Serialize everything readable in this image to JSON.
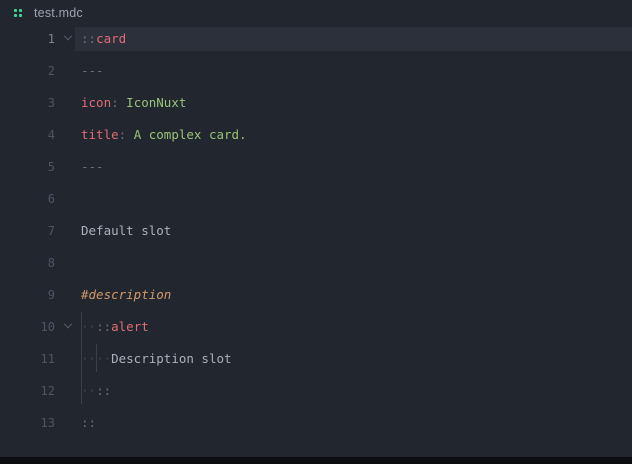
{
  "colors": {
    "background": "#22262e",
    "active_line": "#2b303b",
    "tab_text": "#9ca3b0",
    "icon_green": "#3fd68f",
    "line_number": "#4d5566",
    "line_number_active": "#7e8695",
    "punctuation": "#66707f",
    "tag": "#e06c75",
    "key": "#e06c75",
    "string": "#98c379",
    "text": "#a9b1be",
    "slot": "#d19a66",
    "whitespace": "#404654",
    "indent_guide": "#3a404c",
    "chevron": "#5a6272",
    "bottom_bar": "#0b0d11"
  },
  "tab": {
    "filename": "test.mdc",
    "icon": "mdc-four-dots-icon"
  },
  "editor": {
    "lines": [
      {
        "number": "1",
        "chevron": true,
        "active": true,
        "segments": [
          {
            "t": "::",
            "c": "punct"
          },
          {
            "t": "card",
            "c": "tag"
          }
        ]
      },
      {
        "number": "2",
        "chevron": false,
        "active": false,
        "segments": [
          {
            "t": "---",
            "c": "punct"
          }
        ]
      },
      {
        "number": "3",
        "chevron": false,
        "active": false,
        "segments": [
          {
            "t": "icon",
            "c": "key"
          },
          {
            "t": ":",
            "c": "punct"
          },
          {
            "t": " IconNuxt",
            "c": "str"
          }
        ]
      },
      {
        "number": "4",
        "chevron": false,
        "active": false,
        "segments": [
          {
            "t": "title",
            "c": "key"
          },
          {
            "t": ":",
            "c": "punct"
          },
          {
            "t": " A complex card.",
            "c": "str"
          }
        ]
      },
      {
        "number": "5",
        "chevron": false,
        "active": false,
        "segments": [
          {
            "t": "---",
            "c": "punct"
          }
        ]
      },
      {
        "number": "6",
        "chevron": false,
        "active": false,
        "segments": []
      },
      {
        "number": "7",
        "chevron": false,
        "active": false,
        "segments": [
          {
            "t": "Default slot",
            "c": "txt"
          }
        ]
      },
      {
        "number": "8",
        "chevron": false,
        "active": false,
        "segments": []
      },
      {
        "number": "9",
        "chevron": false,
        "active": false,
        "segments": [
          {
            "t": "#description",
            "c": "slot"
          }
        ]
      },
      {
        "number": "10",
        "chevron": true,
        "active": false,
        "segments": [
          {
            "t": "  ",
            "c": "ws"
          },
          {
            "t": "::",
            "c": "punct"
          },
          {
            "t": "alert",
            "c": "tag"
          }
        ]
      },
      {
        "number": "11",
        "chevron": false,
        "active": false,
        "segments": [
          {
            "t": "    ",
            "c": "ws"
          },
          {
            "t": "Description slot",
            "c": "txt"
          }
        ]
      },
      {
        "number": "12",
        "chevron": false,
        "active": false,
        "segments": [
          {
            "t": "  ",
            "c": "ws"
          },
          {
            "t": "::",
            "c": "punct"
          }
        ]
      },
      {
        "number": "13",
        "chevron": false,
        "active": false,
        "segments": [
          {
            "t": "::",
            "c": "punct"
          }
        ]
      }
    ],
    "indent_guides": [
      {
        "col": 0,
        "from_line": 10,
        "to_line": 12
      },
      {
        "col": 2,
        "from_line": 11,
        "to_line": 11
      }
    ]
  }
}
